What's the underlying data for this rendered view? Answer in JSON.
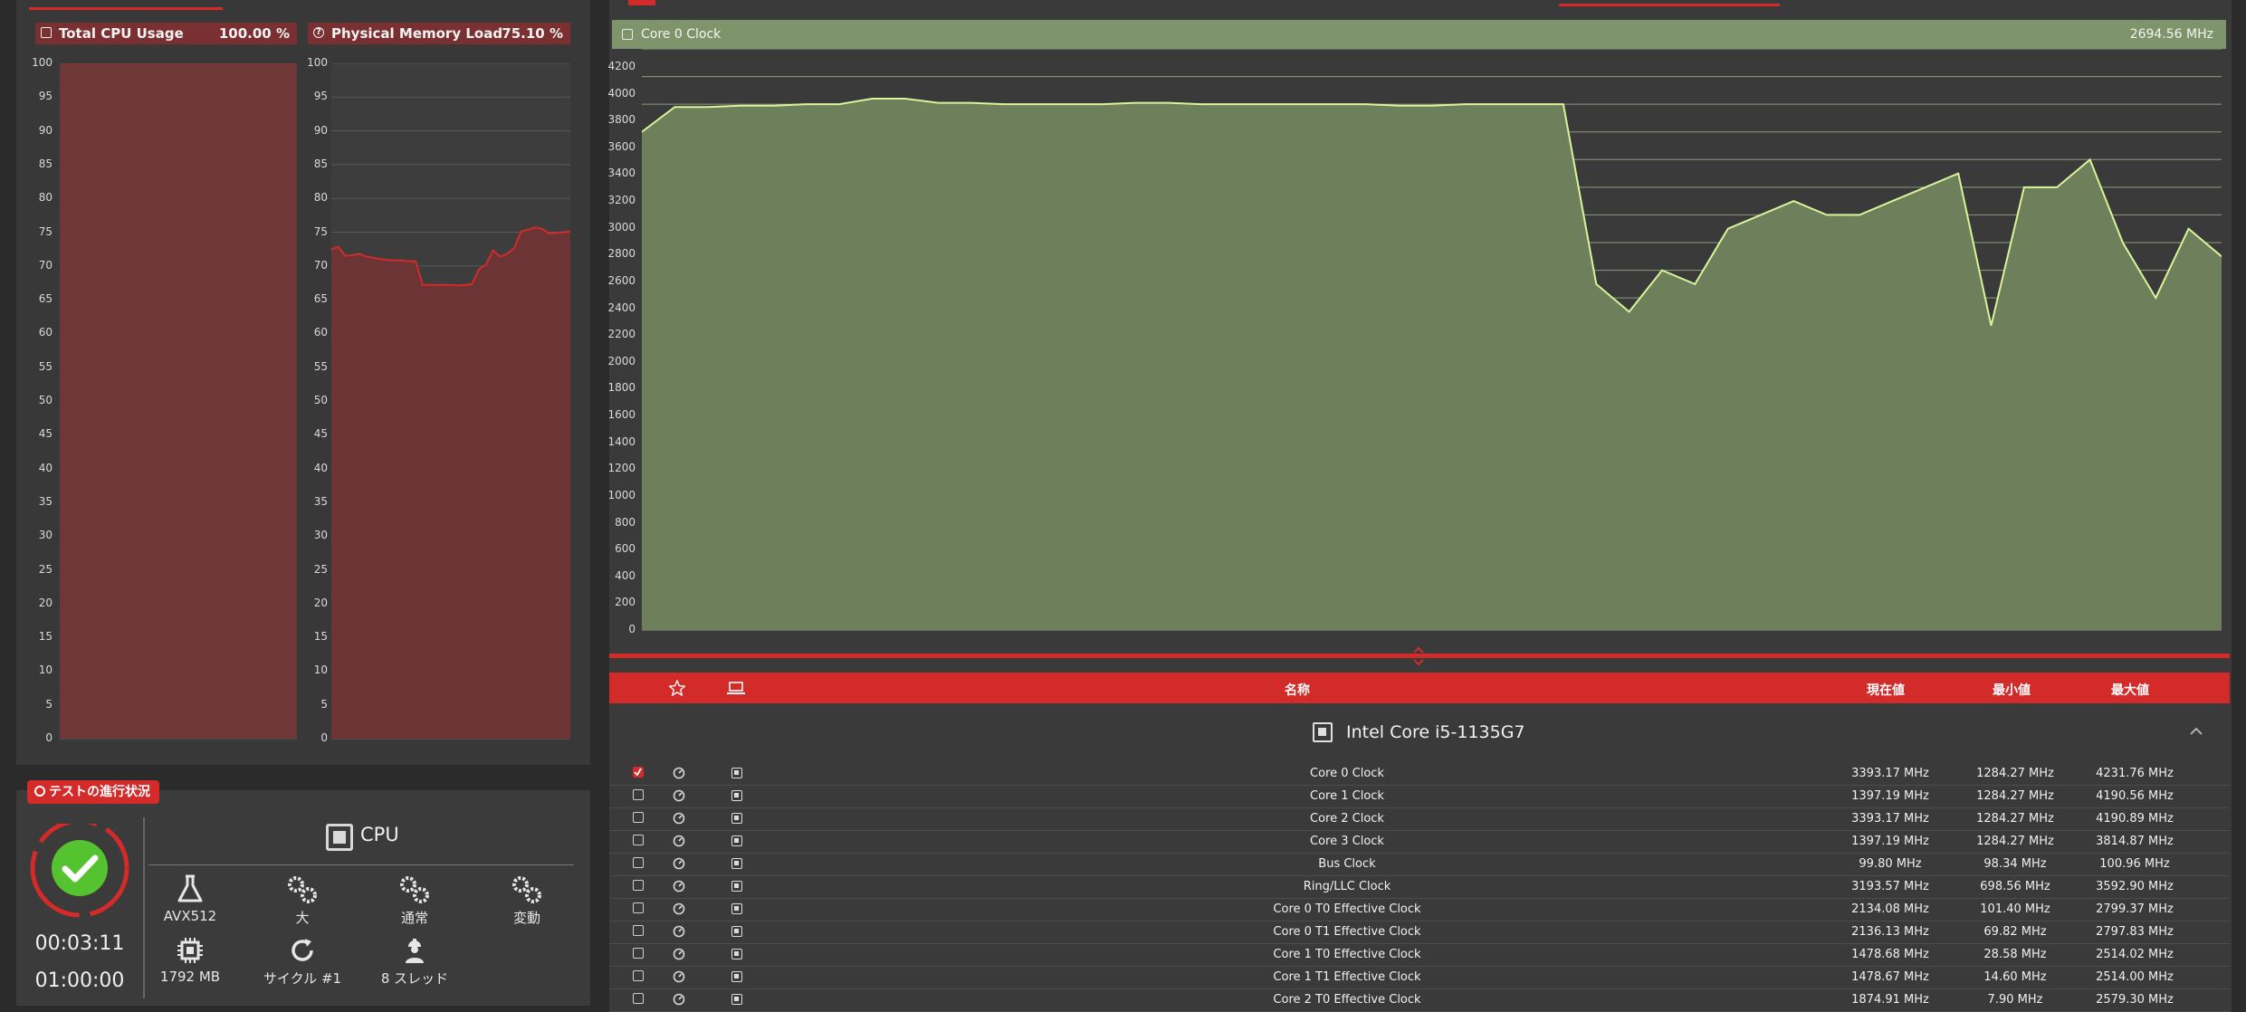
{
  "colors": {
    "accent_red": "#d32a2a",
    "cpu_chart_fill": "#6e3738",
    "memory_line": "#d32a2a",
    "clock_fill": "#6e7f5b",
    "clock_line": "#d8f59a",
    "ok_green": "#55c230"
  },
  "left_charts": [
    {
      "icon": "chip-icon",
      "title": "Total CPU Usage",
      "value": "100.00 %",
      "ticks": [
        "100",
        "95",
        "90",
        "85",
        "80",
        "75",
        "70",
        "65",
        "60",
        "55",
        "50",
        "45",
        "40",
        "35",
        "30",
        "25",
        "20",
        "15",
        "10",
        "5",
        "0"
      ]
    },
    {
      "icon": "question-circle-icon",
      "title": "Physical Memory Load",
      "value": "75.10 %",
      "ticks": [
        "100",
        "95",
        "90",
        "85",
        "80",
        "75",
        "70",
        "65",
        "60",
        "55",
        "50",
        "45",
        "40",
        "35",
        "30",
        "25",
        "20",
        "15",
        "10",
        "5",
        "0"
      ]
    }
  ],
  "progress": {
    "badge": "テストの進行状況",
    "elapsed": "00:03:11",
    "total": "01:00:00",
    "target_label": "CPU",
    "items": [
      {
        "icon": "flask-icon",
        "label": "AVX512"
      },
      {
        "icon": "gears-icon",
        "label": "大"
      },
      {
        "icon": "gears-icon",
        "label": "通常"
      },
      {
        "icon": "gears-icon",
        "label": "変動"
      },
      {
        "icon": "chip-icon",
        "label": "1792 MB"
      },
      {
        "icon": "refresh-icon",
        "label": "サイクル #1"
      },
      {
        "icon": "worker-icon",
        "label": "8 スレッド"
      }
    ]
  },
  "clock_chart": {
    "title": "Core 0 Clock",
    "value": "2694.56 MHz",
    "ticks": [
      "4200",
      "4000",
      "3800",
      "3600",
      "3400",
      "3200",
      "3000",
      "2800",
      "2600",
      "2400",
      "2200",
      "2000",
      "1800",
      "1600",
      "1400",
      "1200",
      "1000",
      "800",
      "600",
      "400",
      "200",
      "0"
    ]
  },
  "chart_data": [
    {
      "type": "area",
      "title": "Total CPU Usage",
      "ylim": [
        0,
        100
      ],
      "series": [
        {
          "name": "Total CPU Usage",
          "values": [
            100,
            100,
            100,
            100,
            100,
            100,
            100,
            100,
            100,
            100,
            100,
            100,
            100,
            100,
            100,
            100,
            100,
            100,
            100,
            100
          ]
        }
      ]
    },
    {
      "type": "line",
      "title": "Physical Memory Load",
      "ylim": [
        0,
        100
      ],
      "series": [
        {
          "name": "Physical Memory Load",
          "values": [
            72.5,
            72.8,
            71.5,
            71.6,
            71.8,
            71.4,
            71.2,
            71.0,
            70.9,
            70.8,
            70.8,
            70.7,
            70.7,
            67.2,
            67.2,
            67.2,
            67.2,
            67.2,
            67.1,
            67.2,
            67.3,
            69.5,
            70.2,
            72.3,
            71.4,
            71.8,
            72.6,
            75.1,
            75.4,
            75.7,
            75.5,
            74.8,
            74.9,
            75.0,
            75.1
          ]
        }
      ]
    },
    {
      "type": "area",
      "title": "Core 0 Clock",
      "ylim": [
        0,
        4200
      ],
      "series": [
        {
          "name": "Core 0 Clock",
          "values": [
            3600,
            3780,
            3780,
            3790,
            3790,
            3800,
            3800,
            3840,
            3840,
            3810,
            3810,
            3800,
            3800,
            3800,
            3800,
            3810,
            3810,
            3800,
            3800,
            3800,
            3800,
            3800,
            3800,
            3790,
            3790,
            3800,
            3800,
            3800,
            3800,
            2500,
            2300,
            2600,
            2500,
            2900,
            3000,
            3100,
            3000,
            3000,
            3100,
            3200,
            3300,
            2200,
            3200,
            3200,
            3400,
            2800,
            2400,
            2900,
            2700
          ]
        }
      ]
    }
  ],
  "grid": {
    "headers": {
      "name": "名称",
      "current": "現在値",
      "min": "最小値",
      "max": "最大値"
    },
    "group": "Intel Core i5-1135G7",
    "rows": [
      {
        "checked": true,
        "name": "Core 0 Clock",
        "current": "3393.17 MHz",
        "min": "1284.27 MHz",
        "max": "4231.76 MHz"
      },
      {
        "checked": false,
        "name": "Core 1 Clock",
        "current": "1397.19 MHz",
        "min": "1284.27 MHz",
        "max": "4190.56 MHz"
      },
      {
        "checked": false,
        "name": "Core 2 Clock",
        "current": "3393.17 MHz",
        "min": "1284.27 MHz",
        "max": "4190.89 MHz"
      },
      {
        "checked": false,
        "name": "Core 3 Clock",
        "current": "1397.19 MHz",
        "min": "1284.27 MHz",
        "max": "3814.87 MHz"
      },
      {
        "checked": false,
        "name": "Bus Clock",
        "current": "99.80 MHz",
        "min": "98.34 MHz",
        "max": "100.96 MHz"
      },
      {
        "checked": false,
        "name": "Ring/LLC Clock",
        "current": "3193.57 MHz",
        "min": "698.56 MHz",
        "max": "3592.90 MHz"
      },
      {
        "checked": false,
        "name": "Core 0 T0 Effective Clock",
        "current": "2134.08 MHz",
        "min": "101.40 MHz",
        "max": "2799.37 MHz"
      },
      {
        "checked": false,
        "name": "Core 0 T1 Effective Clock",
        "current": "2136.13 MHz",
        "min": "69.82 MHz",
        "max": "2797.83 MHz"
      },
      {
        "checked": false,
        "name": "Core 1 T0 Effective Clock",
        "current": "1478.68 MHz",
        "min": "28.58 MHz",
        "max": "2514.02 MHz"
      },
      {
        "checked": false,
        "name": "Core 1 T1 Effective Clock",
        "current": "1478.67 MHz",
        "min": "14.60 MHz",
        "max": "2514.00 MHz"
      },
      {
        "checked": false,
        "name": "Core 2 T0 Effective Clock",
        "current": "1874.91 MHz",
        "min": "7.90 MHz",
        "max": "2579.30 MHz"
      }
    ]
  }
}
